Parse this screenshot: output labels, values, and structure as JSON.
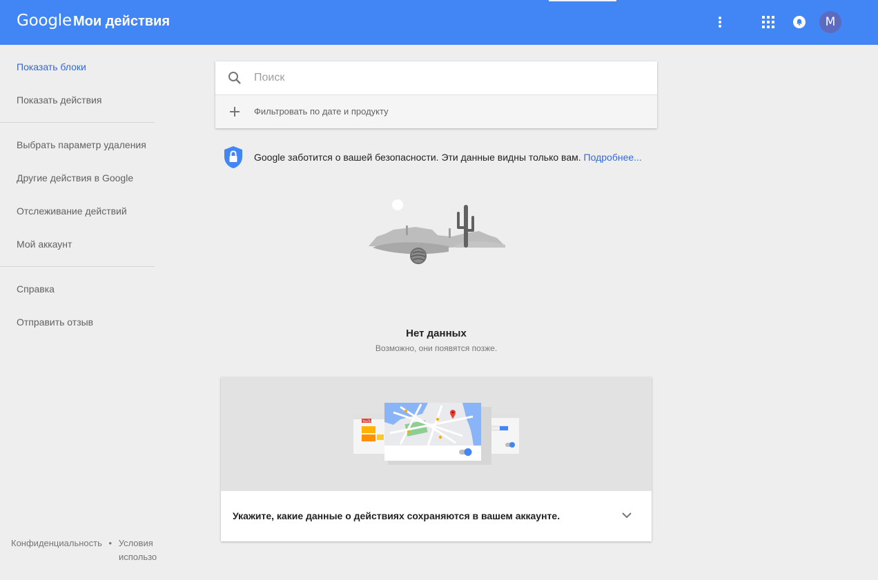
{
  "header": {
    "logo_text": "Google",
    "app_title": "Мои действия",
    "avatar_letter": "M",
    "background_color": "#4285f4",
    "icons": [
      "more-vert-icon",
      "apps-grid-icon",
      "notifications-bell-icon"
    ]
  },
  "sidebar": {
    "items": [
      {
        "label": "Показать блоки",
        "active": true
      },
      {
        "label": "Показать действия",
        "active": false
      },
      {
        "label": "Выбрать параметр удаления",
        "active": false
      },
      {
        "label": "Другие действия в Google",
        "active": false
      },
      {
        "label": "Отслеживание действий",
        "active": false
      },
      {
        "label": "Мой аккаунт",
        "active": false
      },
      {
        "label": "Справка",
        "active": false
      },
      {
        "label": "Отправить отзыв",
        "active": false
      }
    ],
    "footer": {
      "privacy": "Конфиденциальность",
      "separator": "•",
      "terms_line1": "Условия",
      "terms_line2": "использо"
    }
  },
  "search": {
    "placeholder": "Поиск",
    "value": "",
    "filter_label": "Фильтровать по дате и продукту"
  },
  "notice": {
    "text": "Google заботится о вашей безопасности. Эти данные видны только вам.",
    "link": "Подробнее..."
  },
  "empty_state": {
    "title": "Нет данных",
    "subtitle": "Возможно, они появятся позже."
  },
  "controls_card": {
    "text": "Укажите, какие данные о действиях сохраняются в вашем аккаунте.",
    "youtube_label": "YouTube"
  },
  "colors": {
    "accent": "#4285f4",
    "link": "#3367d6",
    "background": "#eeeeee"
  }
}
